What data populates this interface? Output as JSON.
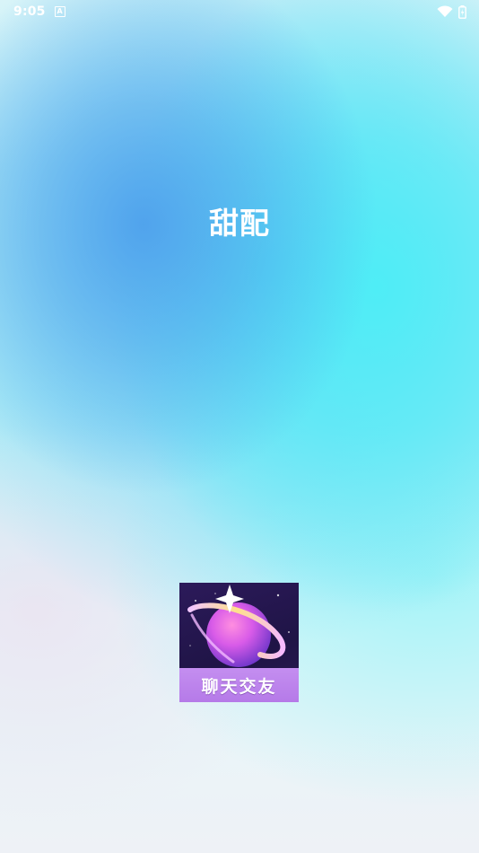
{
  "status_bar": {
    "time": "9:05",
    "notification_icon": "a-icon",
    "wifi_icon": "wifi-icon",
    "battery_icon": "battery-icon"
  },
  "splash": {
    "app_name": "甜配"
  },
  "logo": {
    "caption": "聊天交友",
    "icon": "planet-star-icon"
  },
  "colors": {
    "title_text": "#ffffff",
    "logo_bg": "#231650",
    "logo_banner": "#bd85ec"
  }
}
